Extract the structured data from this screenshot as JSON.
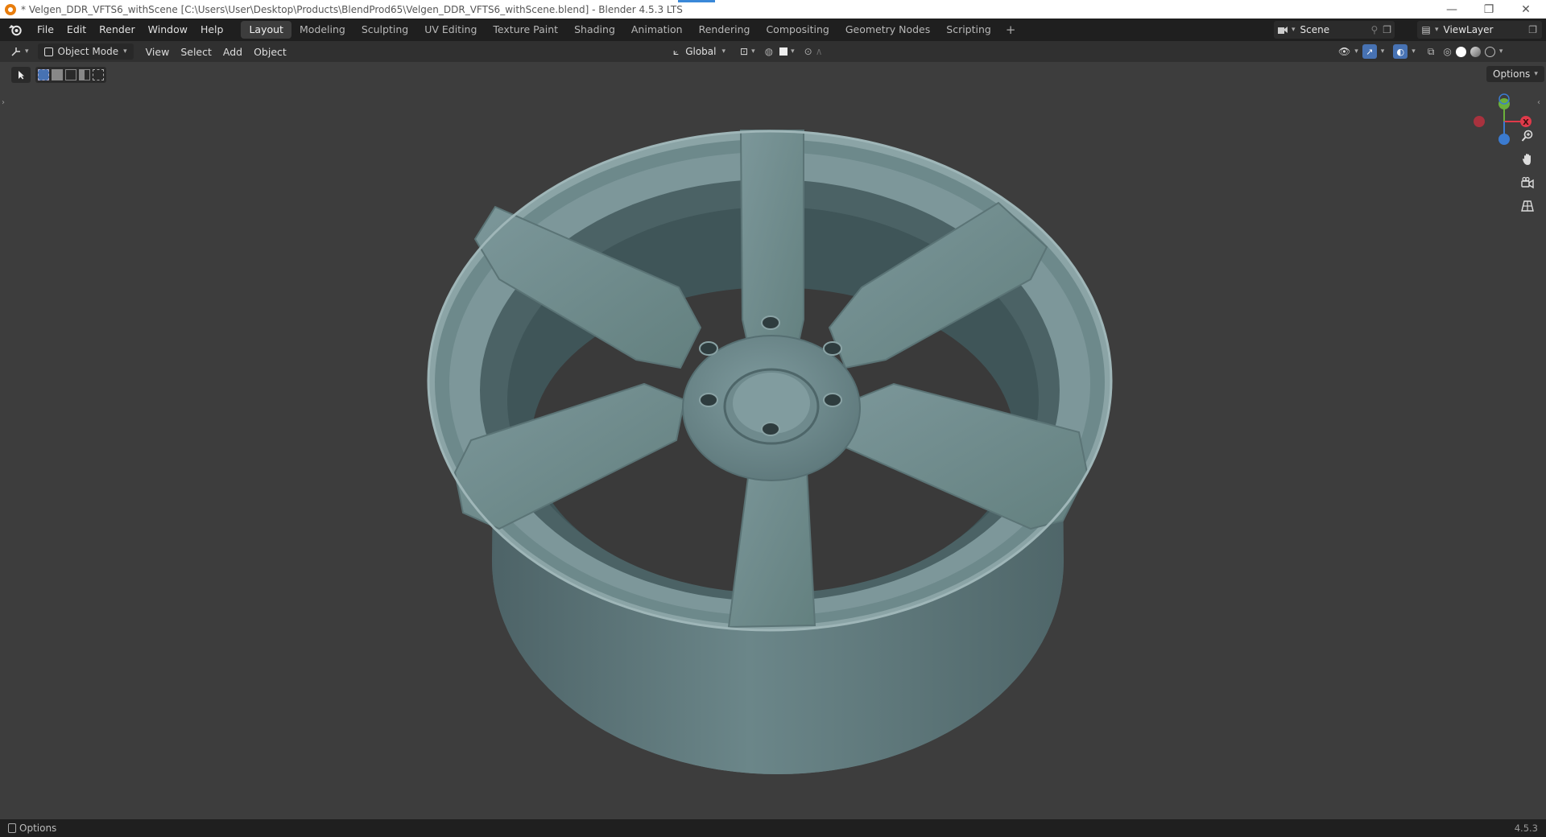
{
  "window": {
    "title": "* Velgen_DDR_VFTS6_withScene [C:\\Users\\User\\Desktop\\Products\\BlendProd65\\Velgen_DDR_VFTS6_withScene.blend] - Blender 4.5.3 LTS",
    "minimize": "—",
    "maximize": "❐",
    "close": "✕"
  },
  "menus": [
    "File",
    "Edit",
    "Render",
    "Window",
    "Help"
  ],
  "workspaces": [
    "Layout",
    "Modeling",
    "Sculpting",
    "UV Editing",
    "Texture Paint",
    "Shading",
    "Animation",
    "Rendering",
    "Compositing",
    "Geometry Nodes",
    "Scripting"
  ],
  "active_workspace": "Layout",
  "add_workspace": "+",
  "scene": {
    "name": "Scene"
  },
  "view_layer": {
    "name": "ViewLayer"
  },
  "header": {
    "mode": "Object Mode",
    "menus": [
      "View",
      "Select",
      "Add",
      "Object"
    ],
    "orientation": "Global"
  },
  "viewport": {
    "options_label": "Options",
    "gizmo": {
      "x": "X",
      "y": "Y",
      "z": "Z"
    },
    "nav_icons": [
      "zoom-icon",
      "pan-hand-icon",
      "camera-icon",
      "grid-icon"
    ]
  },
  "status": {
    "left_label": "Options",
    "version": "4.5.3"
  },
  "colors": {
    "accent": "#4772b3",
    "axis_x": "#e03a4a",
    "axis_y": "#6ab03b",
    "axis_z": "#3b7bd0",
    "wheel": "#6e8a8d"
  }
}
